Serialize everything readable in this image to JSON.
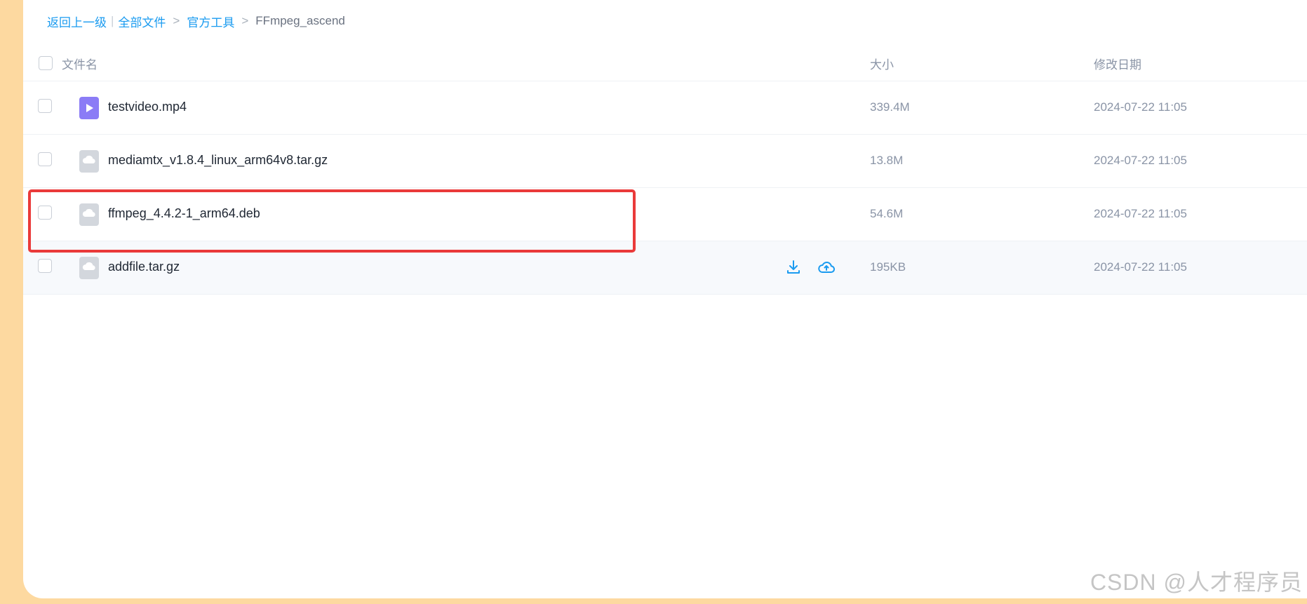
{
  "breadcrumb": {
    "back": "返回上一级",
    "all_files": "全部文件",
    "folder1": "官方工具",
    "current": "FFmpeg_ascend",
    "sep_bar": "|",
    "sep_gt": ">"
  },
  "table": {
    "headers": {
      "name": "文件名",
      "size": "大小",
      "date": "修改日期"
    },
    "rows": [
      {
        "name": "testvideo.mp4",
        "size": "339.4M",
        "date": "2024-07-22 11:05",
        "icon": "video-file-icon"
      },
      {
        "name": "mediamtx_v1.8.4_linux_arm64v8.tar.gz",
        "size": "13.8M",
        "date": "2024-07-22 11:05",
        "icon": "cloud-file-icon"
      },
      {
        "name": "ffmpeg_4.4.2-1_arm64.deb",
        "size": "54.6M",
        "date": "2024-07-22 11:05",
        "icon": "cloud-file-icon"
      },
      {
        "name": "addfile.tar.gz",
        "size": "195KB",
        "date": "2024-07-22 11:05",
        "icon": "cloud-file-icon"
      }
    ]
  },
  "row_actions": [
    "download-icon",
    "save-to-cloud-icon"
  ],
  "colors": {
    "accent": "#1a9bf0",
    "highlight": "#ea3a3a",
    "video_icon": "#8b7cf6",
    "side_background": "#fdd9a0"
  },
  "watermark": "CSDN @人才程序员"
}
